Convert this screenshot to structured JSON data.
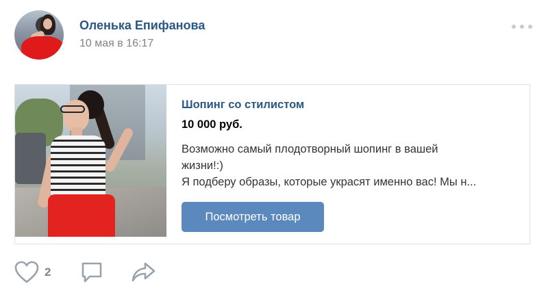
{
  "post": {
    "author_name": "Оленька Епифанова",
    "date": "10 мая в 16:17",
    "more_icon": "more-dots-icon"
  },
  "product": {
    "title": "Шопинг со стилистом",
    "price": "10 000 руб.",
    "description_lines": [
      "Возможно самый плодотворный шопинг в вашей",
      "жизни!:)",
      "Я подберу образы, которые украсят именно вас! Мы н..."
    ],
    "button_label": "Посмотреть товар"
  },
  "actions": {
    "like_count": "2",
    "icons": [
      "heart-icon",
      "comment-icon",
      "share-icon"
    ]
  },
  "colors": {
    "link_blue": "#2a5885",
    "button_blue": "#5b88bd",
    "muted_gray": "#828282",
    "border": "#dce1e6",
    "icon_gray": "#99a2ad"
  }
}
